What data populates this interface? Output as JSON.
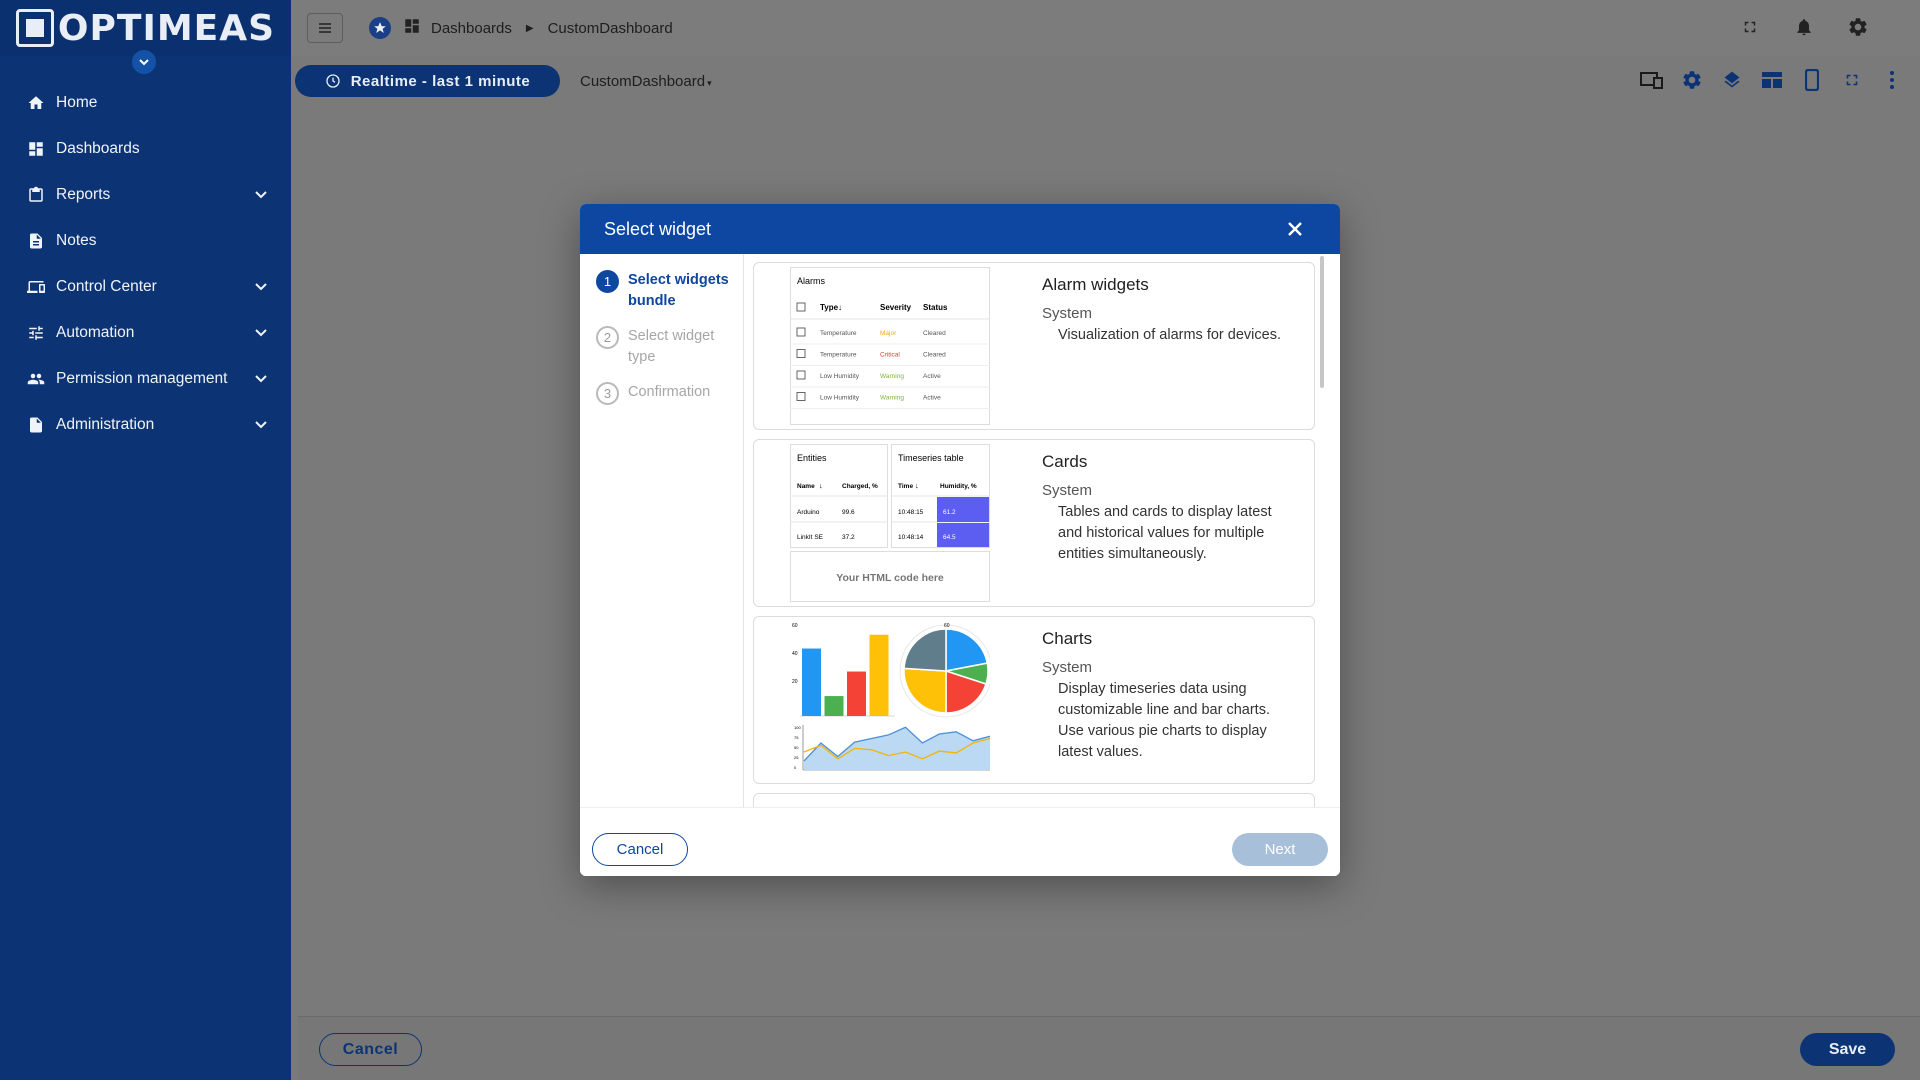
{
  "sidebar": {
    "logo": "OPTIMEAS",
    "items": [
      {
        "label": "Home",
        "icon": "home-icon",
        "expandable": false
      },
      {
        "label": "Dashboards",
        "icon": "dashboards-icon",
        "expandable": false
      },
      {
        "label": "Reports",
        "icon": "clipboard-icon",
        "expandable": true
      },
      {
        "label": "Notes",
        "icon": "document-icon",
        "expandable": false
      },
      {
        "label": "Control Center",
        "icon": "devices-icon",
        "expandable": true
      },
      {
        "label": "Automation",
        "icon": "sliders-icon",
        "expandable": true
      },
      {
        "label": "Permission management",
        "icon": "people-icon",
        "expandable": true
      },
      {
        "label": "Administration",
        "icon": "admin-document-icon",
        "expandable": true
      }
    ]
  },
  "topbar": {
    "breadcrumb": [
      "Dashboards",
      "CustomDashboard"
    ]
  },
  "toolbar": {
    "timewindow": "Realtime - last 1 minute",
    "dashboard_name": "CustomDashboard"
  },
  "dialog": {
    "title": "Select widget",
    "steps": [
      {
        "num": "1",
        "label": "Select widgets bundle",
        "active": true
      },
      {
        "num": "2",
        "label": "Select widget type",
        "active": false
      },
      {
        "num": "3",
        "label": "Confirmation",
        "active": false
      }
    ],
    "bundles": [
      {
        "title": "Alarm widgets",
        "owner": "System",
        "description": "Visualization of alarms for devices."
      },
      {
        "title": "Cards",
        "owner": "System",
        "description": "Tables and cards to display latest and historical values for multiple entities simultaneously."
      },
      {
        "title": "Charts",
        "owner": "System",
        "description": "Display timeseries data using customizable line and bar charts. Use various pie charts to display latest values."
      }
    ],
    "alarm_preview": {
      "title": "Alarms",
      "headers": [
        "Type",
        "Severity",
        "Status"
      ],
      "rows": [
        {
          "type": "Temperature",
          "severity": "Major",
          "status": "Cleared",
          "color": "#f5a623"
        },
        {
          "type": "Temperature",
          "severity": "Critical",
          "status": "Cleared",
          "color": "#e53935"
        },
        {
          "type": "Low Humidity",
          "severity": "Warning",
          "status": "Active",
          "color": "#7cb342"
        },
        {
          "type": "Low Humidity",
          "severity": "Warning",
          "status": "Active",
          "color": "#7cb342"
        }
      ]
    },
    "cards_preview": {
      "entities_title": "Entities",
      "entities_headers": [
        "Name",
        "Charged, %"
      ],
      "entities_rows": [
        [
          "Arduino",
          "99.6"
        ],
        [
          "LinkIt SE",
          "37.2"
        ]
      ],
      "ts_title": "Timeseries table",
      "ts_headers": [
        "Time",
        "Humidity, %"
      ],
      "ts_rows": [
        [
          "10:48:15",
          "61.2"
        ],
        [
          "10:48:14",
          "64.5"
        ]
      ],
      "html_text": "Your HTML code here"
    },
    "charts_preview": {
      "bar_ticks": [
        "60",
        "40",
        "20"
      ],
      "pie_tick": "60",
      "line_ticks": [
        "100",
        "75",
        "50",
        "25",
        "0"
      ],
      "bars": [
        {
          "value": 44,
          "color": "#2196f3"
        },
        {
          "value": 13,
          "color": "#4caf50"
        },
        {
          "value": 29,
          "color": "#f44336"
        },
        {
          "value": 53,
          "color": "#ffc107"
        }
      ],
      "pie": [
        {
          "value": 22,
          "color": "#2196f3"
        },
        {
          "value": 8,
          "color": "#4caf50"
        },
        {
          "value": 20,
          "color": "#f44336"
        },
        {
          "value": 26,
          "color": "#ffc107"
        },
        {
          "value": 24,
          "color": "#607d8b"
        }
      ],
      "line_blue": [
        20,
        60,
        30,
        62,
        70,
        78,
        95,
        60,
        80,
        85,
        65,
        75
      ],
      "line_yellow": [
        40,
        55,
        25,
        48,
        45,
        32,
        40,
        25,
        42,
        38,
        60,
        70
      ]
    },
    "cancel_label": "Cancel",
    "next_label": "Next"
  },
  "bottombar": {
    "cancel_label": "Cancel",
    "save_label": "Save"
  }
}
